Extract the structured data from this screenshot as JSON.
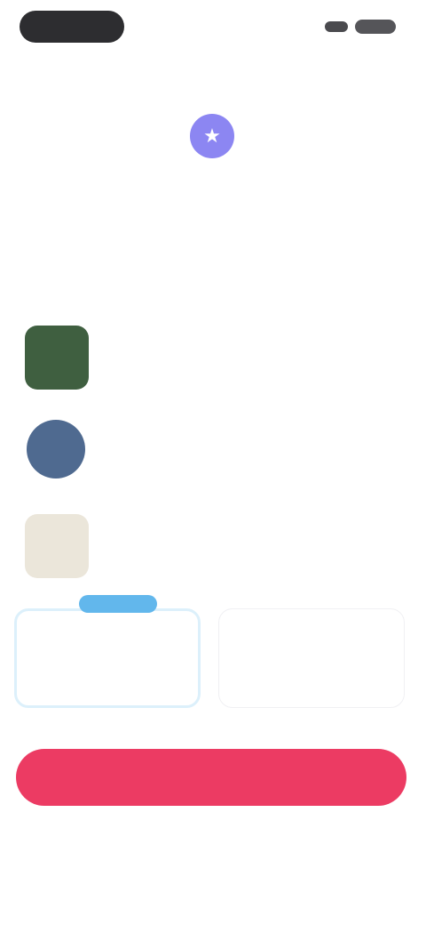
{
  "top_link": {
    "label": ""
  },
  "headline": {
    "text": ""
  },
  "section": {
    "label": "",
    "accent": ""
  },
  "features": [
    {
      "title": "",
      "subtitle": "",
      "color": "#3f5f40",
      "icon": "green-thumbnail"
    },
    {
      "title": "",
      "subtitle": "",
      "color": "#4f6a90",
      "icon": "blue-thumbnail"
    },
    {
      "title": "",
      "subtitle": "",
      "color": "#e8e3d8",
      "icon": "beige-thumbnail"
    }
  ],
  "plans": {
    "selected": {
      "badge": "",
      "name": "",
      "price": "",
      "note": ""
    },
    "other": {
      "name": "",
      "price": "",
      "note": ""
    }
  },
  "cta": {
    "label": ""
  },
  "secondary_link": {
    "label": ""
  },
  "colors": {
    "accent": "#8c86f2",
    "cta": "#ec3b63",
    "badge": "#62b7ec"
  }
}
